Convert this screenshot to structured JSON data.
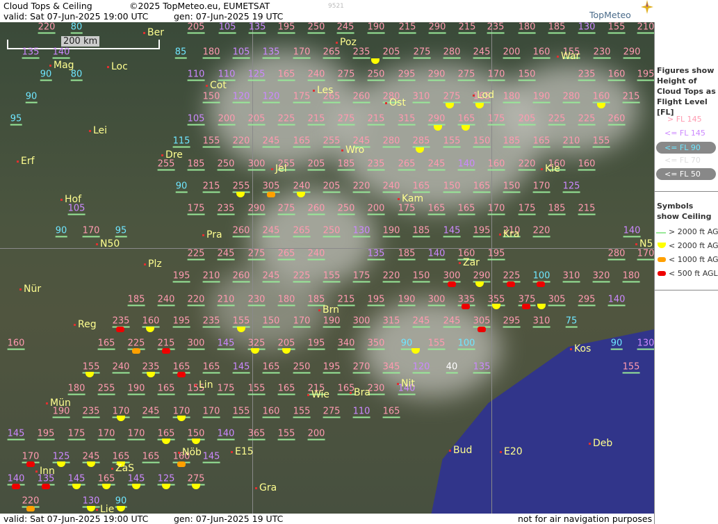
{
  "header": {
    "title": "Cloud Tops & Ceiling",
    "copyright": "©2025 TopMeteo.eu, EUMETSAT",
    "valid": "valid:  Sat   07-Jun-2025  19:00 UTC",
    "generated": "gen: 07-Jun-2025 19 UTC",
    "code": "9521",
    "logo": "TopMeteo"
  },
  "footer": {
    "valid": "valid:  Sat   07-Jun-2025  19:00 UTC",
    "generated": "gen: 07-Jun-2025 19 UTC",
    "disclaimer": "not for air navigation purposes"
  },
  "scale_label": "200 km",
  "legend": {
    "figures_title": "Figures show Height of Cloud Tops as Flight Level  [FL]",
    "levels": [
      "> FL 145",
      "<= FL 145",
      "<= FL 90",
      "<= FL 70",
      "<= FL 50"
    ],
    "symbols_title": "Symbols show Ceiling",
    "ceilings": [
      "> 2000 ft AGL",
      "< 2000 ft AGL",
      "< 1000 ft AGL",
      "< 500 ft AGL"
    ]
  },
  "colors": {
    "pink": "#ff9ab0",
    "violet": "#cc88ff",
    "cyan": "#6fe6ff",
    "sym_yellow": "#ffff00",
    "sym_orange": "#ffa000",
    "sym_red": "#ee0000"
  },
  "cities": [
    "Ber",
    "Poz",
    "War",
    "Mag",
    "Loc",
    "Cot",
    "Les",
    "Ost",
    "Lod",
    "Lei",
    "Wro",
    "Dre",
    "Erf",
    "Jel",
    "Kie",
    "Kam",
    "Hof",
    "Pra",
    "Kra",
    "N50",
    "Plz",
    "Zar",
    "Nür",
    "Brn",
    "Reg",
    "Kos",
    "Nit",
    "Lin",
    "Mün",
    "Wie",
    "Bra",
    "Bud",
    "E20",
    "Deb",
    "Inn",
    "ZaS",
    "Nöb",
    "E15",
    "Gra",
    "Lie",
    "N5"
  ],
  "fl_values": [
    "220",
    "80",
    "205",
    "105",
    "135",
    "195",
    "250",
    "245",
    "190",
    "215",
    "290",
    "215",
    "235",
    "180",
    "185",
    "130",
    "155",
    "210",
    "135",
    "140",
    "85",
    "180",
    "105",
    "135",
    "170",
    "265",
    "235",
    "205",
    "275",
    "280",
    "245",
    "200",
    "160",
    "155",
    "230",
    "290",
    "90",
    "80",
    "110",
    "110",
    "125",
    "165",
    "240",
    "275",
    "250",
    "295",
    "290",
    "275",
    "170",
    "150",
    "235",
    "160",
    "195",
    "90",
    "150",
    "120",
    "120",
    "175",
    "265",
    "260",
    "280",
    "310",
    "275",
    "165",
    "180",
    "190",
    "280",
    "160",
    "215",
    "95",
    "105",
    "200",
    "205",
    "225",
    "215",
    "275",
    "215",
    "315",
    "290",
    "165",
    "175",
    "205",
    "225",
    "225",
    "260",
    "115",
    "155",
    "220",
    "245",
    "165",
    "255",
    "245",
    "280",
    "285",
    "155",
    "150",
    "185",
    "165",
    "210",
    "155",
    "255",
    "185",
    "250",
    "300",
    "255",
    "205",
    "185",
    "235",
    "265",
    "245",
    "140",
    "160",
    "220",
    "160",
    "160",
    "90",
    "215",
    "255",
    "305",
    "240",
    "205",
    "220",
    "240",
    "165",
    "150",
    "165",
    "150",
    "170",
    "125",
    "105",
    "175",
    "235",
    "290",
    "275",
    "260",
    "250",
    "200",
    "175",
    "165",
    "165",
    "170",
    "175",
    "185",
    "215",
    "90",
    "170",
    "95",
    "260",
    "245",
    "265",
    "250",
    "130",
    "190",
    "185",
    "145",
    "195",
    "210",
    "220",
    "140",
    "225",
    "245",
    "275",
    "265",
    "240",
    "135",
    "185",
    "140",
    "160",
    "195",
    "280",
    "170",
    "195",
    "210",
    "260",
    "245",
    "225",
    "155",
    "175",
    "220",
    "150",
    "300",
    "290",
    "225",
    "100",
    "310",
    "320",
    "180",
    "185",
    "240",
    "220",
    "210",
    "230",
    "180",
    "185",
    "215",
    "195",
    "190",
    "300",
    "335",
    "355",
    "375",
    "305",
    "295",
    "140",
    "235",
    "160",
    "195",
    "235",
    "155",
    "150",
    "170",
    "190",
    "300",
    "315",
    "245",
    "245",
    "305",
    "295",
    "310",
    "75",
    "160",
    "165",
    "225",
    "215",
    "300",
    "145",
    "325",
    "205",
    "195",
    "340",
    "350",
    "90",
    "155",
    "100",
    "90",
    "130",
    "155",
    "240",
    "235",
    "165",
    "165",
    "145",
    "165",
    "250",
    "195",
    "270",
    "345",
    "120",
    "40",
    "135",
    "155",
    "180",
    "255",
    "190",
    "165",
    "155",
    "175",
    "155",
    "165",
    "215",
    "165",
    "230",
    "140",
    "190",
    "235",
    "170",
    "245",
    "170",
    "170",
    "155",
    "160",
    "155",
    "275",
    "110",
    "165",
    "145",
    "195",
    "175",
    "170",
    "170",
    "165",
    "150",
    "140",
    "365",
    "155",
    "200",
    "170",
    "125",
    "245",
    "165",
    "165",
    "160",
    "145",
    "140",
    "135",
    "145",
    "165",
    "145",
    "125",
    "275",
    "220",
    "130",
    "90"
  ],
  "map_labels": [
    "N50",
    "E20",
    "E15",
    "N5"
  ]
}
